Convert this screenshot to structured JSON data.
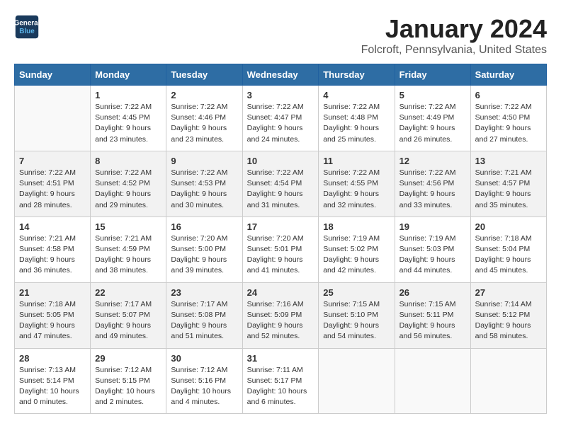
{
  "header": {
    "logo_line1": "General",
    "logo_line2": "Blue",
    "title": "January 2024",
    "subtitle": "Folcroft, Pennsylvania, United States"
  },
  "weekdays": [
    "Sunday",
    "Monday",
    "Tuesday",
    "Wednesday",
    "Thursday",
    "Friday",
    "Saturday"
  ],
  "weeks": [
    [
      {
        "day": "",
        "info": ""
      },
      {
        "day": "1",
        "info": "Sunrise: 7:22 AM\nSunset: 4:45 PM\nDaylight: 9 hours\nand 23 minutes."
      },
      {
        "day": "2",
        "info": "Sunrise: 7:22 AM\nSunset: 4:46 PM\nDaylight: 9 hours\nand 23 minutes."
      },
      {
        "day": "3",
        "info": "Sunrise: 7:22 AM\nSunset: 4:47 PM\nDaylight: 9 hours\nand 24 minutes."
      },
      {
        "day": "4",
        "info": "Sunrise: 7:22 AM\nSunset: 4:48 PM\nDaylight: 9 hours\nand 25 minutes."
      },
      {
        "day": "5",
        "info": "Sunrise: 7:22 AM\nSunset: 4:49 PM\nDaylight: 9 hours\nand 26 minutes."
      },
      {
        "day": "6",
        "info": "Sunrise: 7:22 AM\nSunset: 4:50 PM\nDaylight: 9 hours\nand 27 minutes."
      }
    ],
    [
      {
        "day": "7",
        "info": "Sunrise: 7:22 AM\nSunset: 4:51 PM\nDaylight: 9 hours\nand 28 minutes."
      },
      {
        "day": "8",
        "info": "Sunrise: 7:22 AM\nSunset: 4:52 PM\nDaylight: 9 hours\nand 29 minutes."
      },
      {
        "day": "9",
        "info": "Sunrise: 7:22 AM\nSunset: 4:53 PM\nDaylight: 9 hours\nand 30 minutes."
      },
      {
        "day": "10",
        "info": "Sunrise: 7:22 AM\nSunset: 4:54 PM\nDaylight: 9 hours\nand 31 minutes."
      },
      {
        "day": "11",
        "info": "Sunrise: 7:22 AM\nSunset: 4:55 PM\nDaylight: 9 hours\nand 32 minutes."
      },
      {
        "day": "12",
        "info": "Sunrise: 7:22 AM\nSunset: 4:56 PM\nDaylight: 9 hours\nand 33 minutes."
      },
      {
        "day": "13",
        "info": "Sunrise: 7:21 AM\nSunset: 4:57 PM\nDaylight: 9 hours\nand 35 minutes."
      }
    ],
    [
      {
        "day": "14",
        "info": "Sunrise: 7:21 AM\nSunset: 4:58 PM\nDaylight: 9 hours\nand 36 minutes."
      },
      {
        "day": "15",
        "info": "Sunrise: 7:21 AM\nSunset: 4:59 PM\nDaylight: 9 hours\nand 38 minutes."
      },
      {
        "day": "16",
        "info": "Sunrise: 7:20 AM\nSunset: 5:00 PM\nDaylight: 9 hours\nand 39 minutes."
      },
      {
        "day": "17",
        "info": "Sunrise: 7:20 AM\nSunset: 5:01 PM\nDaylight: 9 hours\nand 41 minutes."
      },
      {
        "day": "18",
        "info": "Sunrise: 7:19 AM\nSunset: 5:02 PM\nDaylight: 9 hours\nand 42 minutes."
      },
      {
        "day": "19",
        "info": "Sunrise: 7:19 AM\nSunset: 5:03 PM\nDaylight: 9 hours\nand 44 minutes."
      },
      {
        "day": "20",
        "info": "Sunrise: 7:18 AM\nSunset: 5:04 PM\nDaylight: 9 hours\nand 45 minutes."
      }
    ],
    [
      {
        "day": "21",
        "info": "Sunrise: 7:18 AM\nSunset: 5:05 PM\nDaylight: 9 hours\nand 47 minutes."
      },
      {
        "day": "22",
        "info": "Sunrise: 7:17 AM\nSunset: 5:07 PM\nDaylight: 9 hours\nand 49 minutes."
      },
      {
        "day": "23",
        "info": "Sunrise: 7:17 AM\nSunset: 5:08 PM\nDaylight: 9 hours\nand 51 minutes."
      },
      {
        "day": "24",
        "info": "Sunrise: 7:16 AM\nSunset: 5:09 PM\nDaylight: 9 hours\nand 52 minutes."
      },
      {
        "day": "25",
        "info": "Sunrise: 7:15 AM\nSunset: 5:10 PM\nDaylight: 9 hours\nand 54 minutes."
      },
      {
        "day": "26",
        "info": "Sunrise: 7:15 AM\nSunset: 5:11 PM\nDaylight: 9 hours\nand 56 minutes."
      },
      {
        "day": "27",
        "info": "Sunrise: 7:14 AM\nSunset: 5:12 PM\nDaylight: 9 hours\nand 58 minutes."
      }
    ],
    [
      {
        "day": "28",
        "info": "Sunrise: 7:13 AM\nSunset: 5:14 PM\nDaylight: 10 hours\nand 0 minutes."
      },
      {
        "day": "29",
        "info": "Sunrise: 7:12 AM\nSunset: 5:15 PM\nDaylight: 10 hours\nand 2 minutes."
      },
      {
        "day": "30",
        "info": "Sunrise: 7:12 AM\nSunset: 5:16 PM\nDaylight: 10 hours\nand 4 minutes."
      },
      {
        "day": "31",
        "info": "Sunrise: 7:11 AM\nSunset: 5:17 PM\nDaylight: 10 hours\nand 6 minutes."
      },
      {
        "day": "",
        "info": ""
      },
      {
        "day": "",
        "info": ""
      },
      {
        "day": "",
        "info": ""
      }
    ]
  ]
}
